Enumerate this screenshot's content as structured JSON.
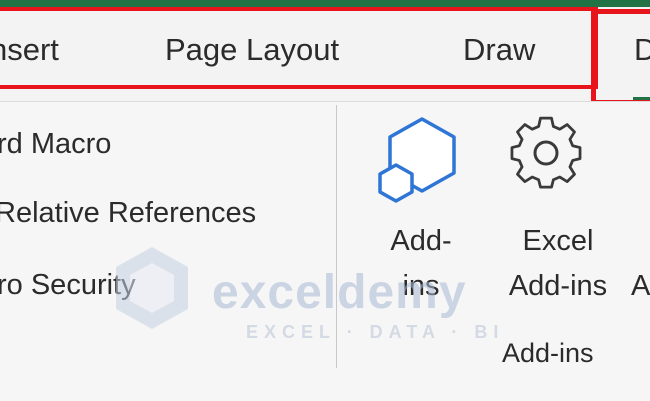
{
  "tabs": [
    {
      "label": "Insert"
    },
    {
      "label": "Page Layout"
    },
    {
      "label": "Draw"
    },
    {
      "label": "Developer"
    }
  ],
  "tabs_visible": {
    "insert": "nsert",
    "page_layout": "Page Layout",
    "draw": "Draw",
    "developer": "D"
  },
  "ribbon": {
    "code_group": {
      "record_macro": "rd Macro",
      "relative_references": "Relative References",
      "macro_security": "ro Security"
    },
    "addins_group": {
      "addins_button": "Add-\nins",
      "addins_line1": "Add-",
      "addins_line2": "ins",
      "excel_addins_line1": "Excel",
      "excel_addins_line2": "Add-ins",
      "cutoff_button": "A",
      "group_label": "Add-ins"
    }
  },
  "watermark": {
    "name": "exceldemy",
    "tagline": "EXCEL · DATA · BI"
  },
  "icons": {
    "addins": "hexagon-addins-icon",
    "excel_addins": "gear-icon"
  },
  "colors": {
    "brand_green": "#217346",
    "highlight_red": "#e8141b",
    "icon_blue": "#2f75d6"
  }
}
